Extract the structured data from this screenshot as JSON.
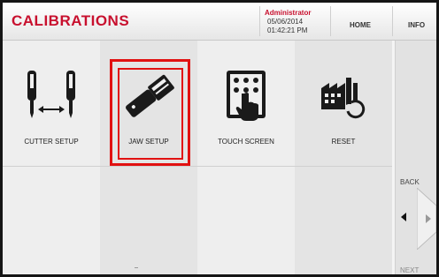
{
  "header": {
    "title": "CALIBRATIONS",
    "user_role": "Administrator",
    "date": "05/06/2014",
    "time": "01:42:21 PM",
    "home_label": "HOME",
    "info_label": "INFO"
  },
  "tiles": [
    {
      "label": "CUTTER SETUP",
      "icon": "cutter-setup-icon"
    },
    {
      "label": "JAW SETUP",
      "icon": "jaw-setup-icon",
      "selected": true
    },
    {
      "label": "TOUCH SCREEN",
      "icon": "touch-screen-icon"
    },
    {
      "label": "RESET",
      "icon": "reset-icon"
    }
  ],
  "nav": {
    "back_label": "BACK",
    "next_label": "NEXT"
  },
  "colors": {
    "accent": "#c8102e",
    "highlight": "#e11111"
  }
}
